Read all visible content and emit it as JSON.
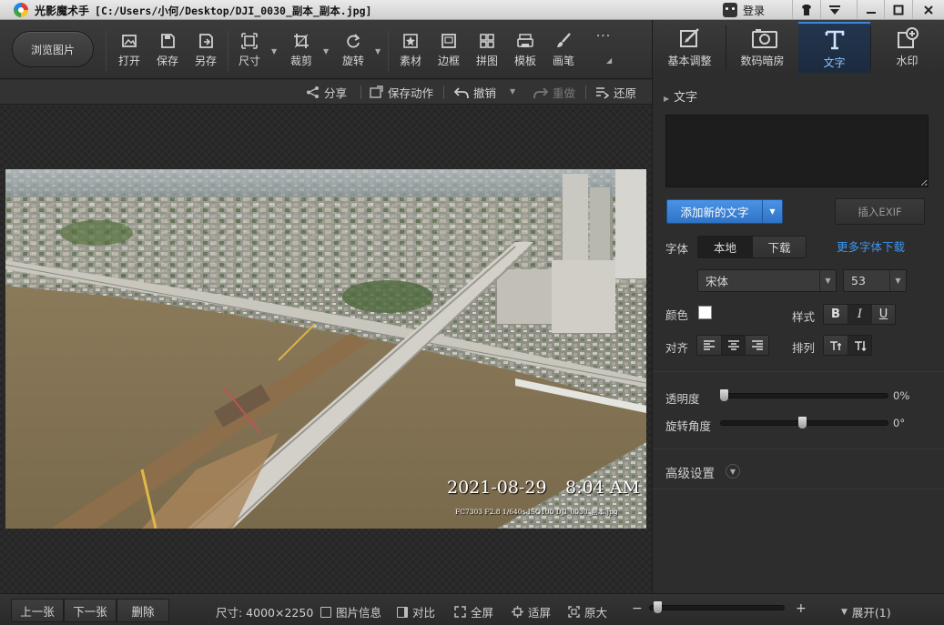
{
  "window": {
    "app_name": "光影魔术手",
    "file_path": "[C:/Users/小何/Desktop/DJI_0030_副本_副本.jpg]",
    "login_label": "登录",
    "controls": [
      "skin-icon",
      "menu-icon",
      "minimize-icon",
      "maximize-icon",
      "close-icon"
    ]
  },
  "toolbar": {
    "browse_label": "浏览图片",
    "tools": [
      {
        "label": "打开",
        "icon": "open-icon"
      },
      {
        "label": "保存",
        "icon": "save-icon"
      },
      {
        "label": "另存",
        "icon": "save-as-icon"
      },
      {
        "label": "尺寸",
        "icon": "resize-icon",
        "dropdown": true
      },
      {
        "label": "裁剪",
        "icon": "crop-icon",
        "dropdown": true
      },
      {
        "label": "旋转",
        "icon": "rotate-icon",
        "dropdown": true
      },
      {
        "label": "素材",
        "icon": "material-icon"
      },
      {
        "label": "边框",
        "icon": "border-icon"
      },
      {
        "label": "拼图",
        "icon": "collage-icon"
      },
      {
        "label": "模板",
        "icon": "template-icon"
      },
      {
        "label": "画笔",
        "icon": "brush-icon"
      }
    ],
    "more_label": "···"
  },
  "subbar": {
    "share": "分享",
    "save_action": "保存动作",
    "undo": "撤销",
    "redo": "重做",
    "restore": "还原"
  },
  "photo": {
    "stamp_date": "2021-08-29",
    "stamp_time": "8:04 AM",
    "stamp_meta": "FC7303 F2.8 1/640s ISO100  DJI_0030_副本.jpg"
  },
  "right_tabs": [
    {
      "label": "基本调整",
      "icon": "adjust-icon"
    },
    {
      "label": "数码暗房",
      "icon": "camera-icon"
    },
    {
      "label": "文字",
      "icon": "text-icon",
      "active": true
    },
    {
      "label": "水印",
      "icon": "watermark-icon"
    }
  ],
  "text_panel": {
    "section_title": "文字",
    "add_text_label": "添加新的文字",
    "insert_exif_label": "插入EXIF",
    "font_label": "字体",
    "font_source_local": "本地",
    "font_source_download": "下载",
    "more_fonts_link": "更多字体下载",
    "font_name": "宋体",
    "font_size": "53",
    "color_label": "颜色",
    "color_value": "#ffffff",
    "style_label": "样式",
    "style_buttons": [
      "B",
      "I",
      "U"
    ],
    "align_label": "对齐",
    "arrange_label": "排列",
    "opacity_label": "透明度",
    "opacity_value": "0%",
    "opacity_fraction": 0.0,
    "rotation_label": "旋转角度",
    "rotation_value": "0°",
    "advanced_label": "高级设置"
  },
  "statusbar": {
    "prev_label": "上一张",
    "next_label": "下一张",
    "delete_label": "删除",
    "size_text": "尺寸: 4000×2250",
    "info_label": "图片信息",
    "compare_label": "对比",
    "fullscreen_label": "全屏",
    "fit_label": "适屏",
    "original_label": "原大",
    "zoom_minus": "−",
    "zoom_plus": "+",
    "expand_label": "展开(1)"
  },
  "colors": {
    "accent": "#3a87e0",
    "link": "#3f94ef",
    "panel_bg": "#2d2d2d"
  }
}
